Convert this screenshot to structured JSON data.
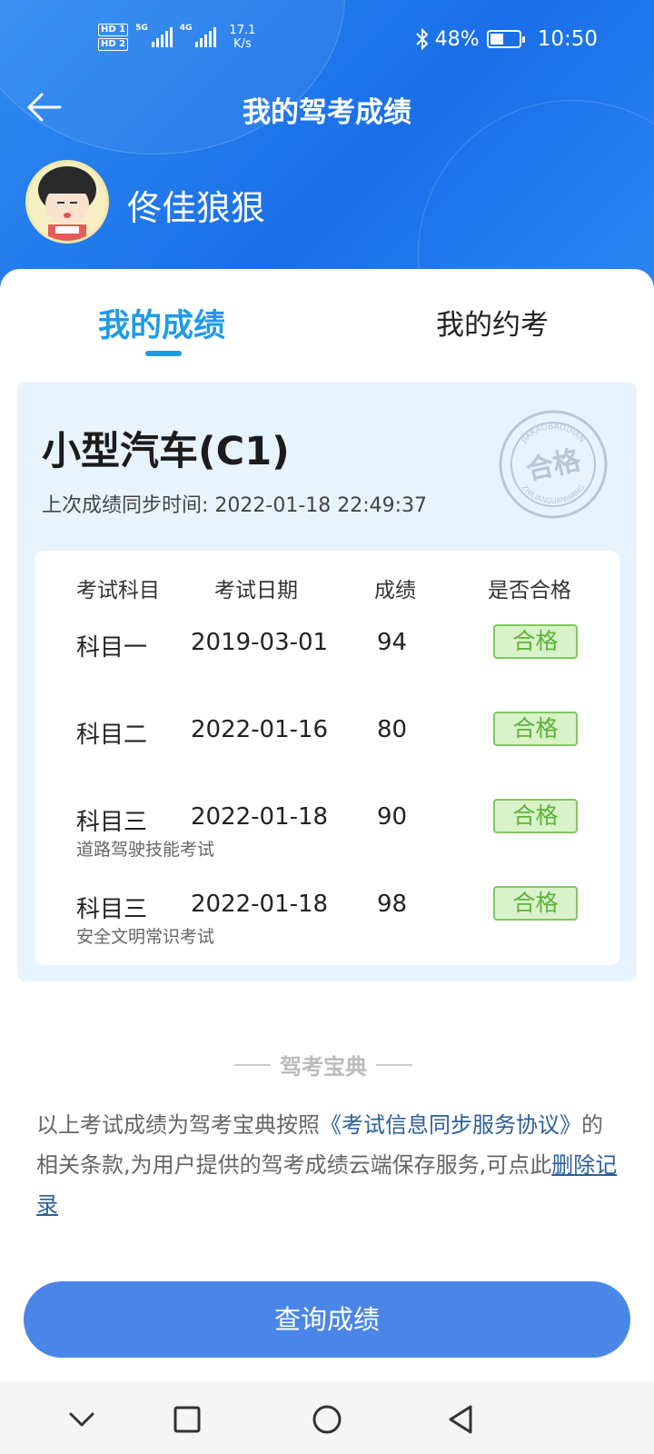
{
  "status_bar": {
    "hd1": "HD 1",
    "hd2": "HD 2",
    "sig1_label": "5G",
    "sig2_label": "4G",
    "speed_value": "17.1",
    "speed_unit": "K/s",
    "battery": "48%",
    "battery_level": 0.48,
    "time": "10:50"
  },
  "header": {
    "title": "我的驾考成绩",
    "username": "佟佳狼狠"
  },
  "tabs": [
    {
      "label": "我的成绩",
      "active": true
    },
    {
      "label": "我的约考",
      "active": false
    }
  ],
  "license": {
    "type": "小型汽车(C1)",
    "sync_text": "上次成绩同步时间: 2022-01-18 22:49:37"
  },
  "stamp": {
    "top_text": "JIAKAOBAODIAN",
    "center_text": "合格",
    "bottom_text": "ZHILIANGUANWANG"
  },
  "table": {
    "headers": [
      "考试科目",
      "考试日期",
      "成绩",
      "是否合格"
    ],
    "rows": [
      {
        "subject": "科目一",
        "date": "2019-03-01",
        "score": "94",
        "result": "合格",
        "note": ""
      },
      {
        "subject": "科目二",
        "date": "2022-01-16",
        "score": "80",
        "result": "合格",
        "note": ""
      },
      {
        "subject": "科目三",
        "date": "2022-01-18",
        "score": "90",
        "result": "合格",
        "note": "道路驾驶技能考试"
      },
      {
        "subject": "科目三",
        "date": "2022-01-18",
        "score": "98",
        "result": "合格",
        "note": "安全文明常识考试"
      }
    ]
  },
  "footer": {
    "brand": "驾考宝典",
    "notice_prefix": "以上考试成绩为驾考宝典按照",
    "notice_link": "《考试信息同步服务协议》",
    "notice_mid": "的相关条款,为用户提供的驾考成绩云端保存服务,可点此",
    "notice_delete": "删除记录"
  },
  "query_button": "查询成绩",
  "colors": {
    "header_blue": "#1a6fe8",
    "accent_tab": "#1e9be8",
    "pass_green": "#5cb33a",
    "button_blue": "#4a86e8",
    "link_blue": "#2b5f9a"
  },
  "icons": {
    "back": "arrow-left-icon",
    "nav_down": "chevron-down-icon",
    "nav_recent": "square-icon",
    "nav_home": "circle-icon",
    "nav_back": "triangle-back-icon"
  }
}
